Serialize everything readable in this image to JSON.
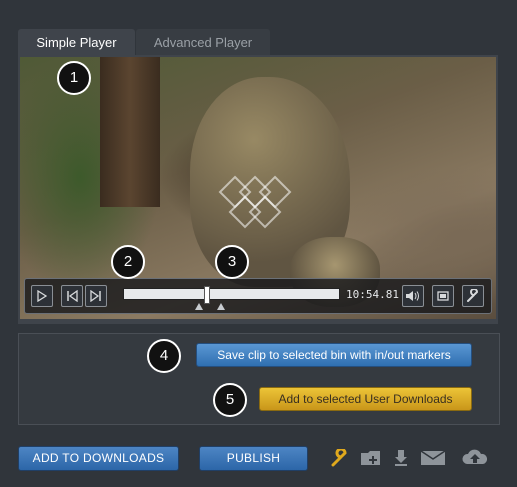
{
  "tabs": [
    {
      "label": "Simple Player",
      "active": true
    },
    {
      "label": "Advanced Player",
      "active": false
    }
  ],
  "player": {
    "timecode": "10:54.81",
    "progress_fraction": 0.38,
    "controls": [
      "play-icon",
      "previous-frame-icon",
      "next-frame-icon",
      "volume-icon",
      "fullscreen-icon",
      "wrench-icon"
    ]
  },
  "callouts": [
    "1",
    "2",
    "3",
    "4",
    "5"
  ],
  "clip": {
    "save_label": "Save clip to selected bin with in/out markers",
    "add_label": "Add to selected User Downloads"
  },
  "bottom": {
    "add_downloads_label": "ADD TO DOWNLOADS",
    "publish_label": "PUBLISH",
    "icons": [
      "wrench-icon",
      "add-folder-icon",
      "download-icon",
      "email-icon",
      "cloud-upload-icon"
    ]
  },
  "colors": {
    "background": "#30353b",
    "accent_blue": "#3a7cc0",
    "accent_yellow": "#dcae27"
  }
}
